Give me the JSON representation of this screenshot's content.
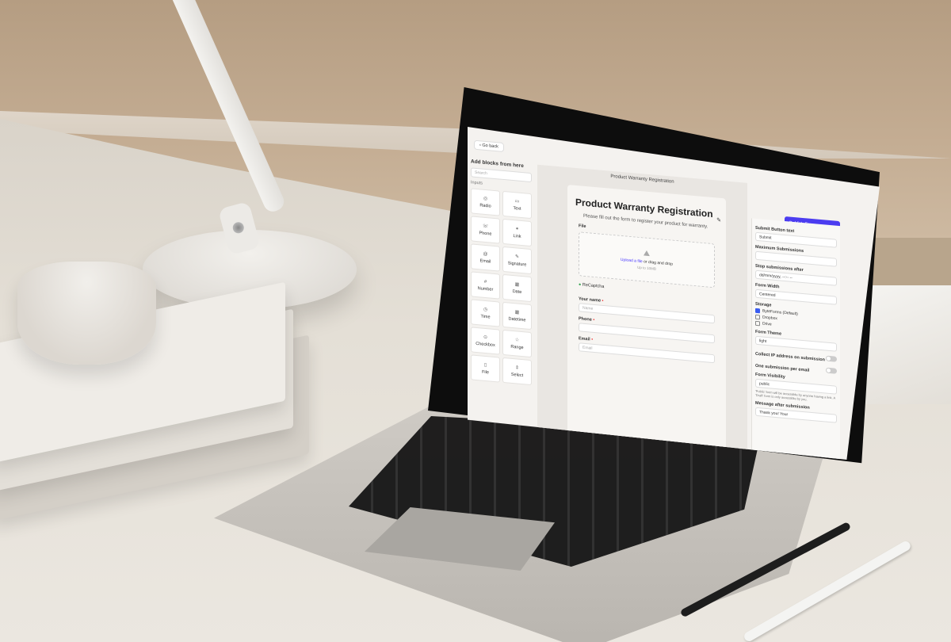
{
  "app": {
    "go_back": "Go back",
    "canvas_title": "Product Warranty Registration",
    "publish_button": "Publish Form"
  },
  "blocks_panel": {
    "title": "Add blocks from here",
    "search_placeholder": "Search",
    "section": "Inputs",
    "items": [
      {
        "label": "Radio",
        "icon": "radio-icon",
        "glyph": "◎"
      },
      {
        "label": "Text",
        "icon": "text-icon",
        "glyph": "▭"
      },
      {
        "label": "Phone",
        "icon": "phone-icon",
        "glyph": "☏"
      },
      {
        "label": "Link",
        "icon": "link-icon",
        "glyph": "⚭"
      },
      {
        "label": "Email",
        "icon": "email-icon",
        "glyph": "@"
      },
      {
        "label": "Signature",
        "icon": "signature-icon",
        "glyph": "✎"
      },
      {
        "label": "Number",
        "icon": "number-icon",
        "glyph": "#"
      },
      {
        "label": "Date",
        "icon": "date-icon",
        "glyph": "▦"
      },
      {
        "label": "Time",
        "icon": "time-icon",
        "glyph": "◷"
      },
      {
        "label": "Datetime",
        "icon": "datetime-icon",
        "glyph": "▦"
      },
      {
        "label": "Checkbox",
        "icon": "checkbox-icon",
        "glyph": "⊙"
      },
      {
        "label": "Range",
        "icon": "range-icon",
        "glyph": "☆"
      },
      {
        "label": "File",
        "icon": "file-icon",
        "glyph": "▯"
      },
      {
        "label": "Select",
        "icon": "select-icon",
        "glyph": "⇕"
      }
    ]
  },
  "form": {
    "title": "Product Warranty Registration",
    "description": "Please fill out the form to register your product for warranty.",
    "file_label": "File",
    "upload_link": "Upload a file",
    "upload_text": " or drag and drop",
    "upload_limit": "Up to 10MB",
    "recaptcha": "ReCaptcha",
    "name_label": "Your name",
    "name_placeholder": "Name",
    "phone_label": "Phone",
    "email_label": "Email",
    "email_placeholder": "Email"
  },
  "settings": {
    "submit_text_label": "Submit Button text",
    "submit_text_value": "Submit",
    "max_submissions_label": "Maximum Submissions",
    "stop_after_label": "Stop submissions after",
    "stop_after_value": "dd/mm/yyyy, --:-- --",
    "form_width_label": "Form Width",
    "form_width_value": "Centered",
    "storage_label": "Storage",
    "storage_options": [
      {
        "label": "ByteForms (Default)",
        "checked": true
      },
      {
        "label": "Dropbox",
        "checked": false
      },
      {
        "label": "Drive",
        "checked": false
      }
    ],
    "theme_label": "Form Theme",
    "theme_value": "light",
    "collect_ip_label": "Collect IP address on submission",
    "one_submission_label": "One submission per email",
    "visibility_label": "Form Visibility",
    "visibility_value": "public",
    "visibility_note": "'Public' form will be accessible by anyone having a link. A 'Draft' form is only accessible by you.",
    "message_after_label": "Message after submission",
    "message_after_value": "Thank you! Your"
  },
  "colors": {
    "accent": "#4b3cf0",
    "required": "#ee3333"
  }
}
